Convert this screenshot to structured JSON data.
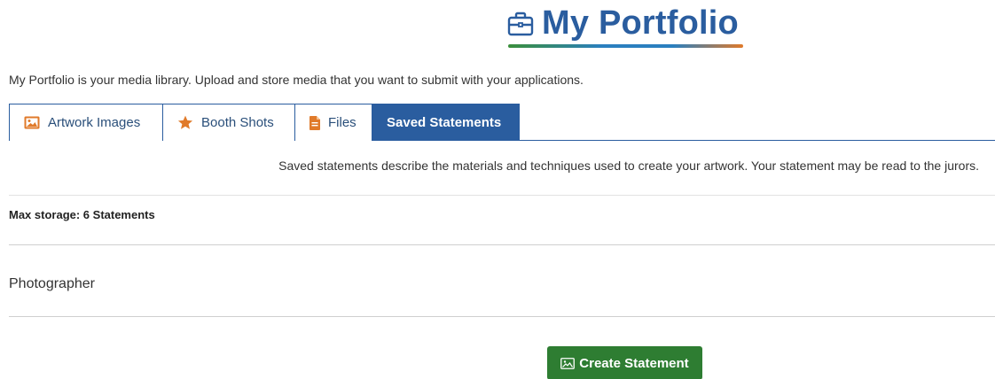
{
  "header": {
    "title": "My Portfolio",
    "icon": "briefcase-icon"
  },
  "intro": "My Portfolio is your media library. Upload and store media that you want to submit with your applications.",
  "tabs": [
    {
      "label": "Artwork Images",
      "icon": "image-icon",
      "active": false
    },
    {
      "label": "Booth Shots",
      "icon": "star-icon",
      "active": false
    },
    {
      "label": "Files",
      "icon": "file-icon",
      "active": false
    },
    {
      "label": "Saved Statements",
      "active": true
    }
  ],
  "description": "Saved statements describe the materials and techniques used to create your artwork. Your statement may be read to the jurors.",
  "max_storage": "Max storage: 6 Statements",
  "statements": [
    {
      "name": "Photographer"
    }
  ],
  "create_button": {
    "label": "Create Statement",
    "icon": "image-icon"
  },
  "colors": {
    "primary": "#2a5d9f",
    "accent_orange": "#e07a2a",
    "button_green": "#2e7d32"
  }
}
